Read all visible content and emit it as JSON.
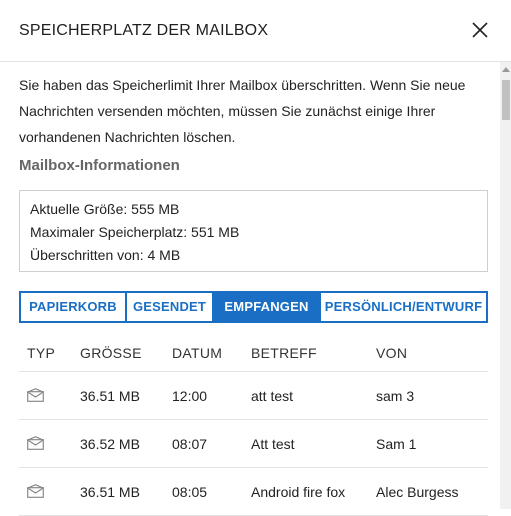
{
  "dialog": {
    "title": "SPEICHERPLATZ DER MAILBOX",
    "intro": "Sie haben das Speicherlimit Ihrer Mailbox überschritten. Wenn Sie neue Nachrichten versenden möchten, müssen Sie zunächst einige Ihrer vorhandenen Nachrichten löschen.",
    "section_title": "Mailbox-Informationen",
    "info": {
      "current_size": "Aktuelle Größe: 555 MB",
      "max_storage": "Maximaler Speicherplatz: 551 MB",
      "exceeded_by": "Überschritten von: 4 MB"
    },
    "tabs": [
      {
        "label": "PAPIERKORB",
        "active": false
      },
      {
        "label": "GESENDET",
        "active": false
      },
      {
        "label": "EMPFANGEN",
        "active": true
      },
      {
        "label": "PERSÖNLICH/ENTWURF",
        "active": false
      }
    ],
    "table": {
      "headers": {
        "typ": "TYP",
        "size": "GRÖSSE",
        "date": "DATUM",
        "subject": "BETREFF",
        "from": "VON"
      },
      "rows": [
        {
          "icon": "envelope-icon",
          "size": "36.51 MB",
          "date": "12:00",
          "subject": "att test",
          "from": "sam 3"
        },
        {
          "icon": "envelope-icon",
          "size": "36.52 MB",
          "date": "08:07",
          "subject": "Att test",
          "from": "Sam 1"
        },
        {
          "icon": "envelope-icon",
          "size": "36.51 MB",
          "date": "08:05",
          "subject": "Android fire fox",
          "from": "Alec Burgess"
        }
      ]
    }
  },
  "colors": {
    "accent": "#1a6fc4",
    "section_title": "#666666",
    "border": "#cfcfcf"
  }
}
